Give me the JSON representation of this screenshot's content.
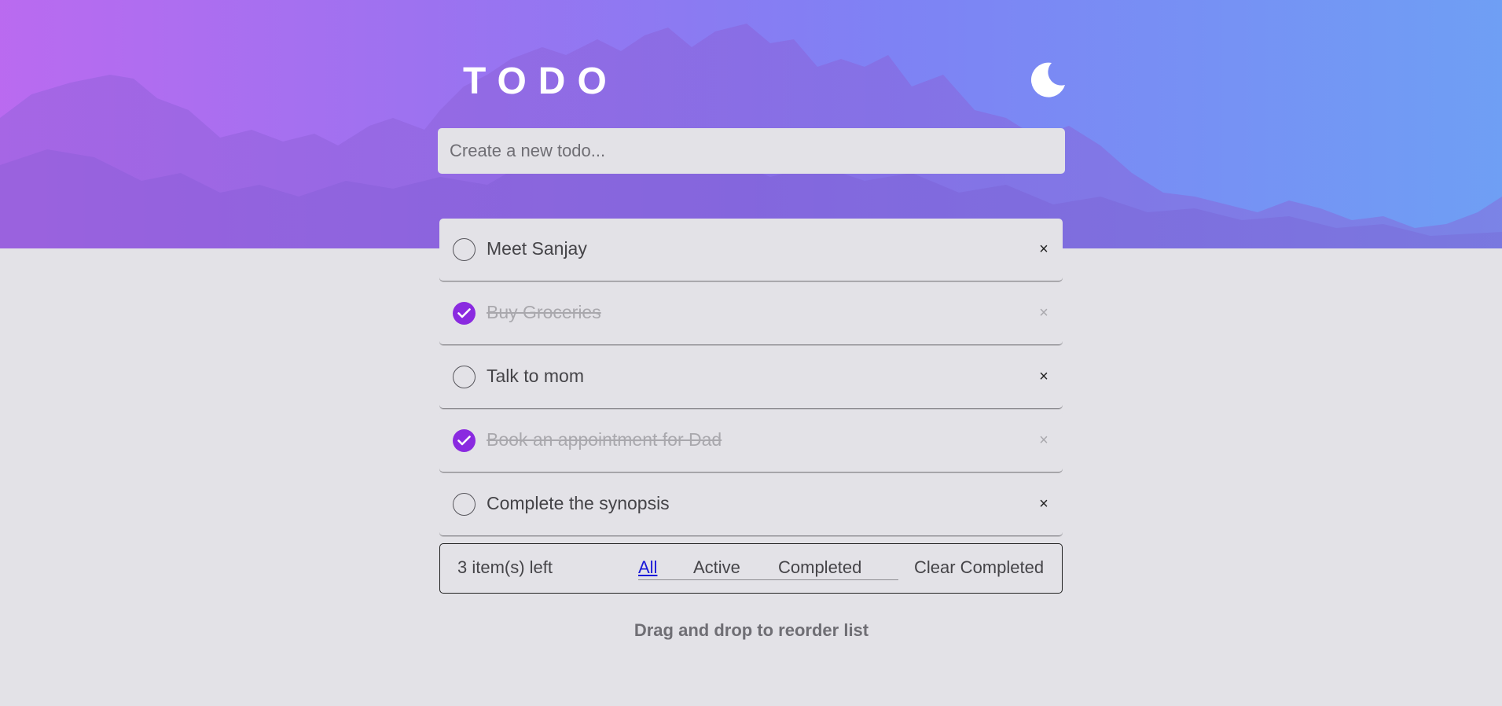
{
  "app": {
    "title": "TODO",
    "theme_toggle_icon": "moon-icon"
  },
  "new_todo": {
    "placeholder": "Create a new todo...",
    "value": ""
  },
  "todos": [
    {
      "text": "Meet Sanjay",
      "completed": false
    },
    {
      "text": "Buy Groceries",
      "completed": true
    },
    {
      "text": "Talk to mom",
      "completed": false
    },
    {
      "text": "Book an appointment for Dad",
      "completed": true
    },
    {
      "text": "Complete the synopsis",
      "completed": false
    }
  ],
  "footer": {
    "items_left": "3 item(s) left",
    "filters": {
      "all": "All",
      "active": "Active",
      "completed": "Completed"
    },
    "selected_filter": "All",
    "clear_completed": "Clear Completed"
  },
  "hint": "Drag and drop to reorder list",
  "colors": {
    "accent": "#8a2ae0",
    "active_filter": "#1a1ad9",
    "background": "#e3e2e7"
  },
  "icons": {
    "delete": "close-icon",
    "check": "check-icon"
  },
  "delete_glyph": "×"
}
